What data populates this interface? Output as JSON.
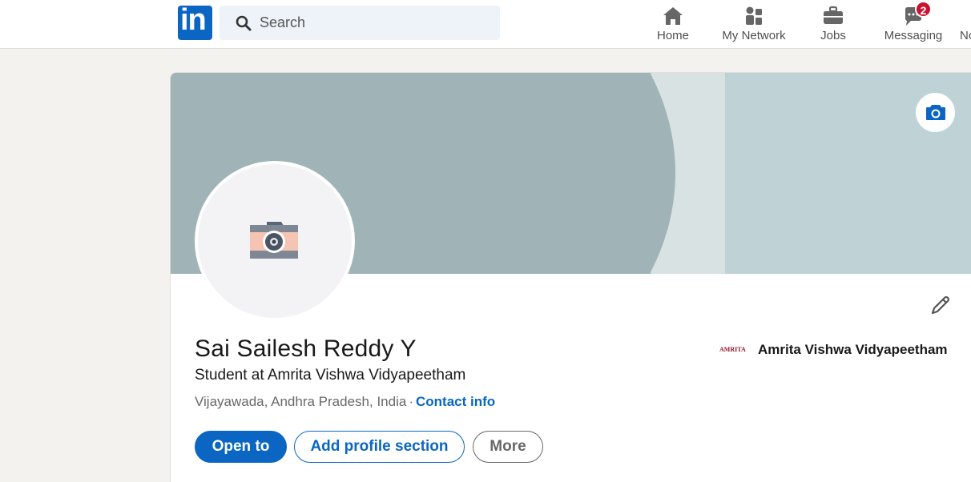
{
  "nav": {
    "logo_text": "in",
    "search": {
      "placeholder": "Search"
    },
    "items": [
      {
        "label": "Home",
        "icon": "home-icon"
      },
      {
        "label": "My Network",
        "icon": "people-icon"
      },
      {
        "label": "Jobs",
        "icon": "briefcase-icon"
      },
      {
        "label": "Messaging",
        "icon": "message-icon",
        "badge": "2"
      },
      {
        "label": "No",
        "icon": "bell-icon"
      }
    ]
  },
  "profile": {
    "name": "Sai Sailesh Reddy Y",
    "headline": "Student at Amrita Vishwa Vidyapeetham",
    "location": "Vijayawada, Andhra Pradesh, India",
    "separator": "·",
    "contact_info": "Contact info",
    "education": {
      "logo_text": "AMRITA",
      "name": "Amrita Vishwa Vidyapeetham"
    },
    "buttons": {
      "open_to": "Open to",
      "add_section": "Add profile section",
      "more": "More"
    }
  },
  "colors": {
    "brand": "#0a66c2",
    "badge": "#cb112d",
    "banner_dark": "#a0b4b7",
    "banner_light": "#bfd3d6"
  }
}
